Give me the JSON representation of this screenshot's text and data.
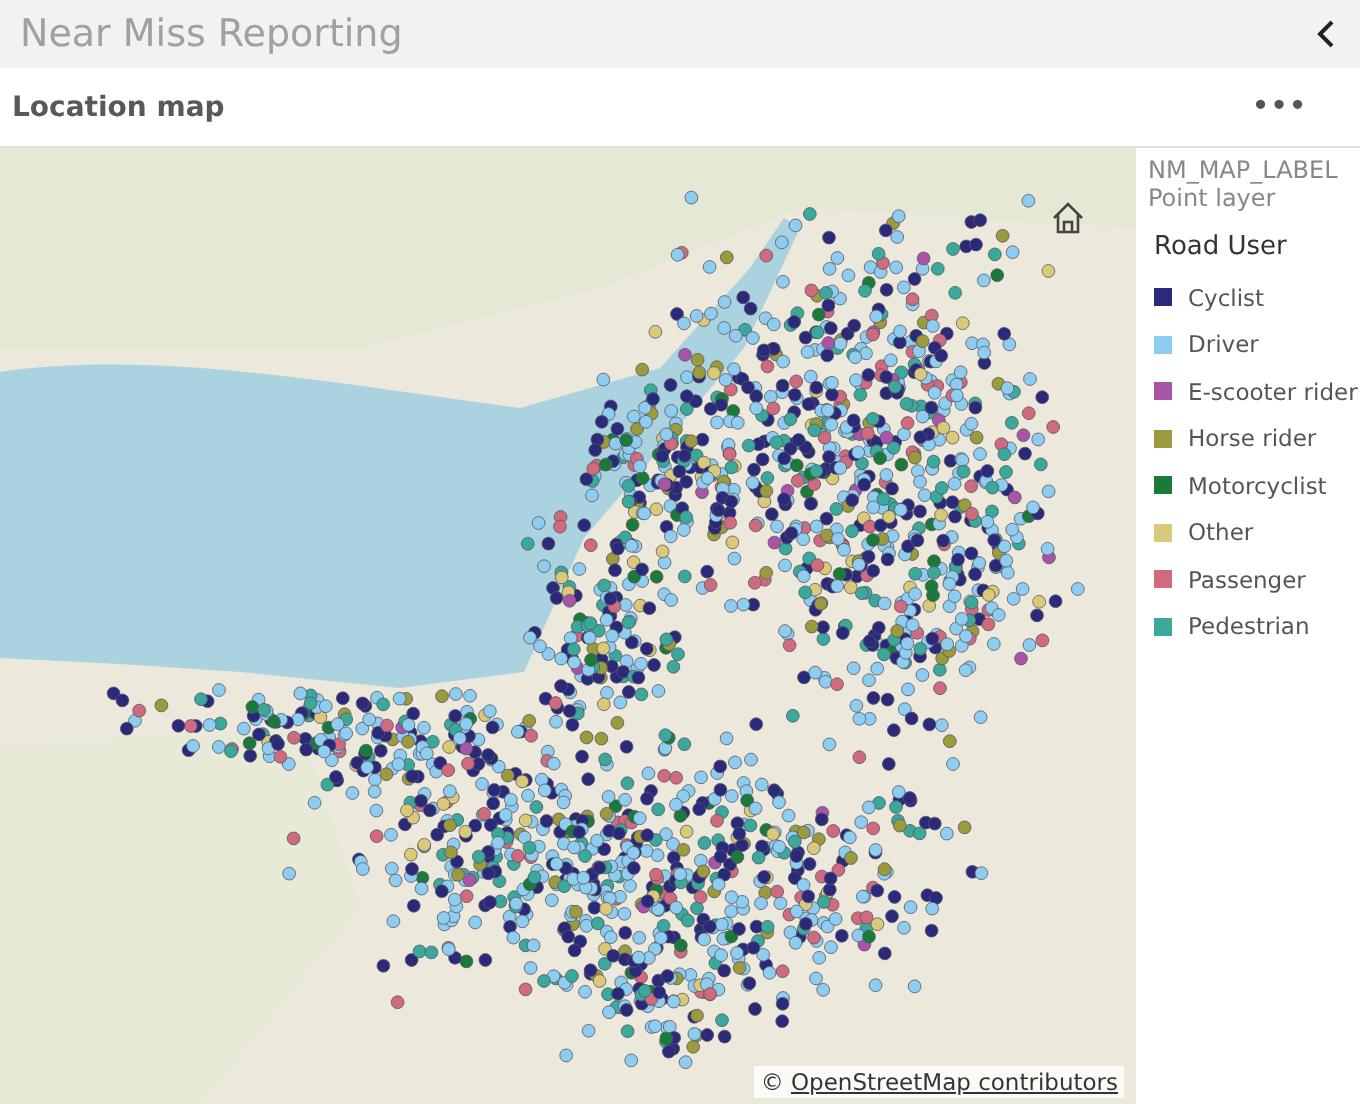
{
  "header": {
    "title": "Near Miss Reporting"
  },
  "panel": {
    "title": "Location map",
    "more": "•••"
  },
  "legend": {
    "layer_name": "NM_MAP_LABEL",
    "layer_type": "Point layer",
    "title": "Road User",
    "items": [
      {
        "label": "Cyclist",
        "color": "#2b2a7a"
      },
      {
        "label": "Driver",
        "color": "#8ecdf0"
      },
      {
        "label": "E-scooter rider",
        "color": "#a855a8"
      },
      {
        "label": "Horse rider",
        "color": "#9b9a3c"
      },
      {
        "label": "Motorcyclist",
        "color": "#1a7a3a"
      },
      {
        "label": "Other",
        "color": "#d9c978"
      },
      {
        "label": "Passenger",
        "color": "#d06a7e"
      },
      {
        "label": "Pedestrian",
        "color": "#3aa89a"
      }
    ]
  },
  "map": {
    "attribution_prefix": "©",
    "attribution_link": "OpenStreetMap contributors"
  }
}
